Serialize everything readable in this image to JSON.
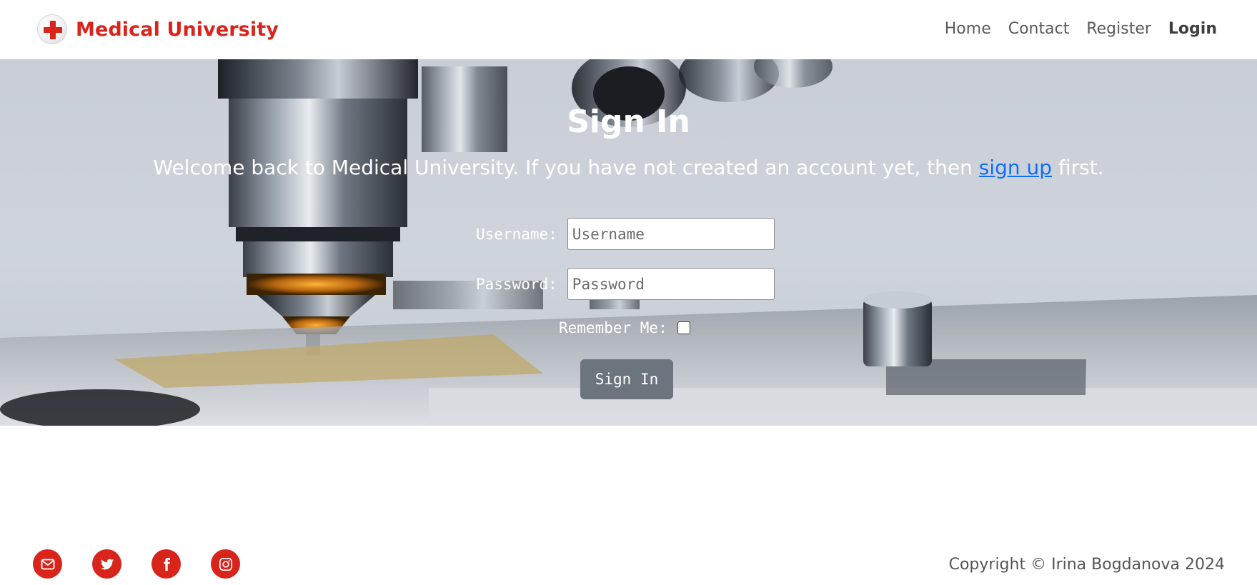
{
  "navbar": {
    "brand": "Medical University",
    "links": [
      "Home",
      "Contact",
      "Register",
      "Login"
    ],
    "active": "Login"
  },
  "hero": {
    "title": "Sign In",
    "subtitle_before": "Welcome back to Medical University. If you have not created an account yet, then ",
    "subtitle_link": "sign up",
    "subtitle_after": " first."
  },
  "form": {
    "username_label": "Username:",
    "username_placeholder": "Username",
    "password_label": "Password:",
    "password_placeholder": "Password",
    "remember_label": "Remember Me:",
    "remember_checked": false,
    "submit_label": "Sign In"
  },
  "footer": {
    "social_icons": [
      "email-icon",
      "twitter-icon",
      "facebook-icon",
      "instagram-icon"
    ],
    "copyright": "Copyright © Irina Bogdanova 2024"
  },
  "colors": {
    "brand": "#d9241c",
    "link": "#0d6efd",
    "button": "#6c757d"
  }
}
